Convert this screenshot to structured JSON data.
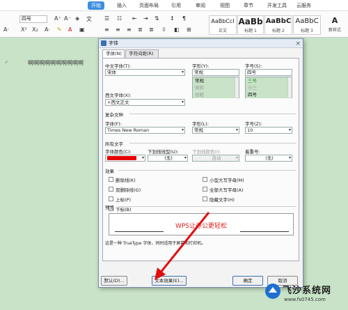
{
  "ribbon": {
    "tabs": [
      "开始",
      "插入",
      "页面布局",
      "引用",
      "审阅",
      "视图",
      "章节",
      "开发工具",
      "云服务"
    ]
  },
  "toolbar": {
    "font_size_combo": "四号",
    "styles": [
      {
        "sample": "AaBbCcI",
        "label": "正文"
      },
      {
        "sample": "AaBb",
        "label": "标题 1"
      },
      {
        "sample": "AaBbC",
        "label": "标题 2"
      },
      {
        "sample": "AaBbC",
        "label": "标题 3"
      },
      {
        "sample": "",
        "label": "新样式"
      }
    ]
  },
  "document": {
    "text": "啊啊啊啊啊啊啊啊啊啊"
  },
  "dialog": {
    "title": "字体",
    "close": "×",
    "tabs": [
      "字体(N)",
      "字符间距(R)"
    ],
    "chinese_font_label": "中文字体(T):",
    "chinese_font_value": "宋体",
    "style_label": "字形(Y):",
    "style_value": "常规",
    "style_list": [
      "常规",
      "倾斜",
      "加粗"
    ],
    "size_label": "字号(S):",
    "size_value": "四号",
    "size_list": [
      "三号",
      "小三",
      "四号"
    ],
    "western_font_label": "西文字体(X):",
    "western_font_value": "+西文正文",
    "complex_section": "复杂文种",
    "complex_font_label": "字体(F):",
    "complex_font_value": "Times New Roman",
    "complex_style_label": "字形(L):",
    "complex_style_value": "常规",
    "complex_size_label": "字号(Z):",
    "complex_size_value": "10",
    "all_text_section": "所有文字",
    "font_color_label": "字体颜色(C):",
    "font_color": "#e60000",
    "underline_label": "下划线线型(U):",
    "underline_value": "(无)",
    "underline_color_label": "下划线颜色(I):",
    "underline_color_value": "自动",
    "emphasis_label": "着重号:",
    "emphasis_value": "(无)",
    "effects_section": "效果",
    "effects_left": [
      "删除线(K)",
      "双删除线(G)",
      "上标(P)",
      "下标(B)"
    ],
    "effects_right": [
      "小型大写字母(M)",
      "全部大写字母(A)",
      "隐藏文字(H)"
    ],
    "preview_section": "预览",
    "preview_text": "WPS让办公更轻松",
    "note": "这是一种 TrueType 字体，同时适用于屏幕和打印机。",
    "buttons": {
      "default": "默认(D)...",
      "text_effects": "文本效果(E)...",
      "ok": "确定",
      "cancel": "取消"
    }
  },
  "watermark": {
    "text": "飞沙系统网",
    "url": "www.fs0745.com"
  }
}
